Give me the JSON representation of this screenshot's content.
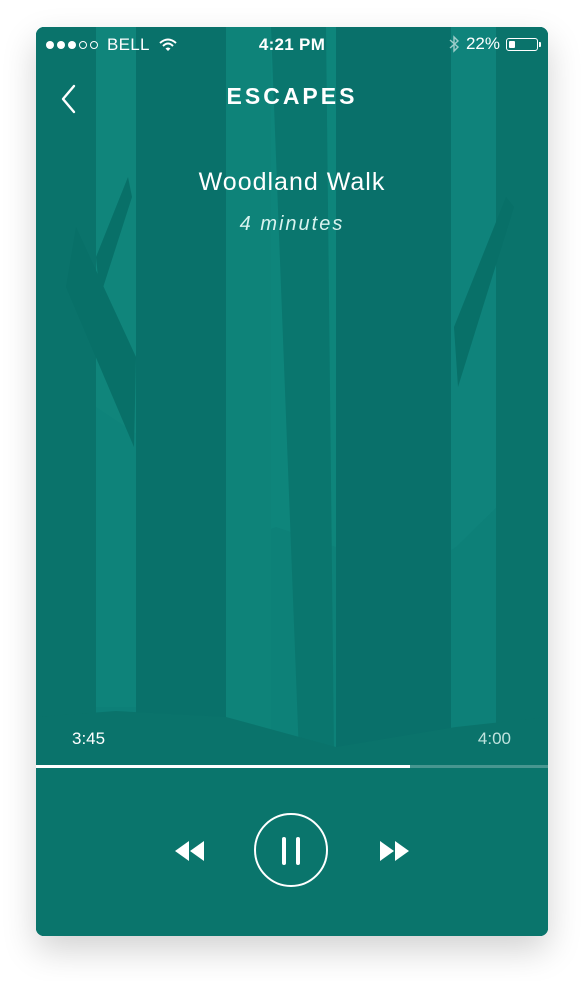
{
  "status_bar": {
    "carrier": "BELL",
    "signal_bars": 3,
    "signal_max": 5,
    "time": "4:21 PM",
    "battery_text": "22%",
    "battery_level": 0.22
  },
  "header": {
    "title": "ESCAPES"
  },
  "track": {
    "title": "Woodland Walk",
    "duration_label": "4 minutes"
  },
  "player": {
    "elapsed": "3:45",
    "total": "4:00",
    "progress": 0.73,
    "state": "playing"
  },
  "colors": {
    "background": "#0c7b73",
    "controls_background": "#0a756c",
    "text": "#ffffff"
  },
  "icons": [
    "chevron-left-icon",
    "wifi-icon",
    "bluetooth-icon",
    "battery-icon",
    "rewind-icon",
    "pause-icon",
    "fast-forward-icon"
  ]
}
